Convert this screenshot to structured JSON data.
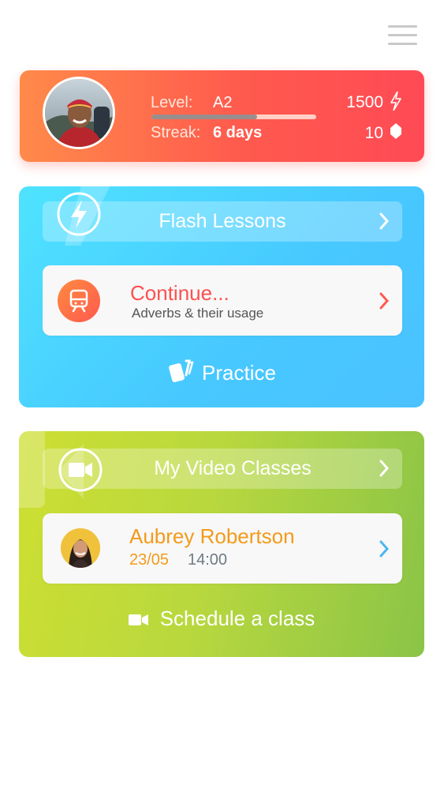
{
  "profile": {
    "level_label": "Level:",
    "level_value": "A2",
    "level_progress": 0.64,
    "streak_label": "Streak:",
    "streak_value": "6 days",
    "points": "1500",
    "gems": "10"
  },
  "flash": {
    "title": "Flash Lessons",
    "continue_title": "Continue...",
    "continue_subtitle": "Adverbs & their usage",
    "practice_label": "Practice"
  },
  "video": {
    "title": "My Video Classes",
    "teacher_name": "Aubrey Robertson",
    "date": "23/05",
    "time": "14:00",
    "schedule_label": "Schedule a class"
  },
  "colors": {
    "coral": "#ff5a4e",
    "orange": "#f39a1a",
    "blue": "#4bc2ff",
    "green": "#9ccb44"
  },
  "icons": [
    "menu-icon",
    "lightning-icon",
    "gem-icon",
    "flash-lightning-icon",
    "train-icon",
    "cards-icon",
    "video-camera-icon",
    "chevron-right-icon"
  ]
}
